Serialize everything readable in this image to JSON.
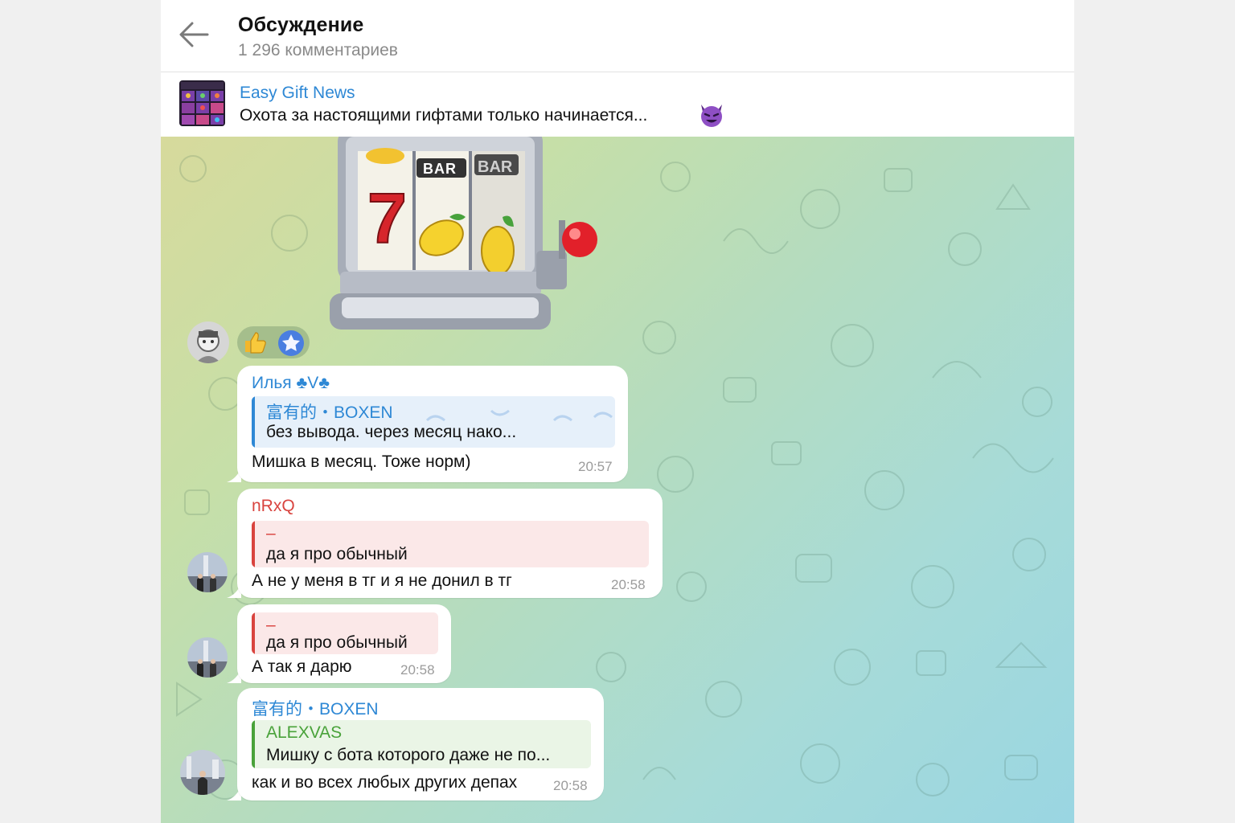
{
  "header": {
    "title": "Обсуждение",
    "subtitle": "1 296 комментариев"
  },
  "pinned": {
    "channel": "Easy Gift News",
    "text": "Охота за настоящими гифтами только начинается..."
  },
  "slot_machine": {
    "reels": [
      "7",
      "BAR",
      "BAR"
    ]
  },
  "messages": [
    {
      "sender": "Илья ♣V♣",
      "quote_name": "富有的・BOXEN",
      "quote_text": "без вывода. через месяц нако...",
      "text": "Мишка в месяц. Тоже норм)",
      "time": "20:57"
    },
    {
      "sender": "nRxQ",
      "quote_name": "–",
      "quote_text": "да я про обычный",
      "text": "А не у меня в тг и я не донил в тг",
      "time": "20:58"
    },
    {
      "quote_name": "–",
      "quote_text": "да я про обычный",
      "text": "А так я дарю",
      "time": "20:58"
    },
    {
      "sender": "富有的・BOXEN",
      "quote_name": "ALEXVAS",
      "quote_text": "Мишку с бота которого даже не по...",
      "text": "как и во всех любых других депах",
      "time": "20:58"
    }
  ],
  "colors": {
    "link_blue": "#2e88d5",
    "name_red": "#d9443f",
    "name_green": "#49a23a"
  }
}
